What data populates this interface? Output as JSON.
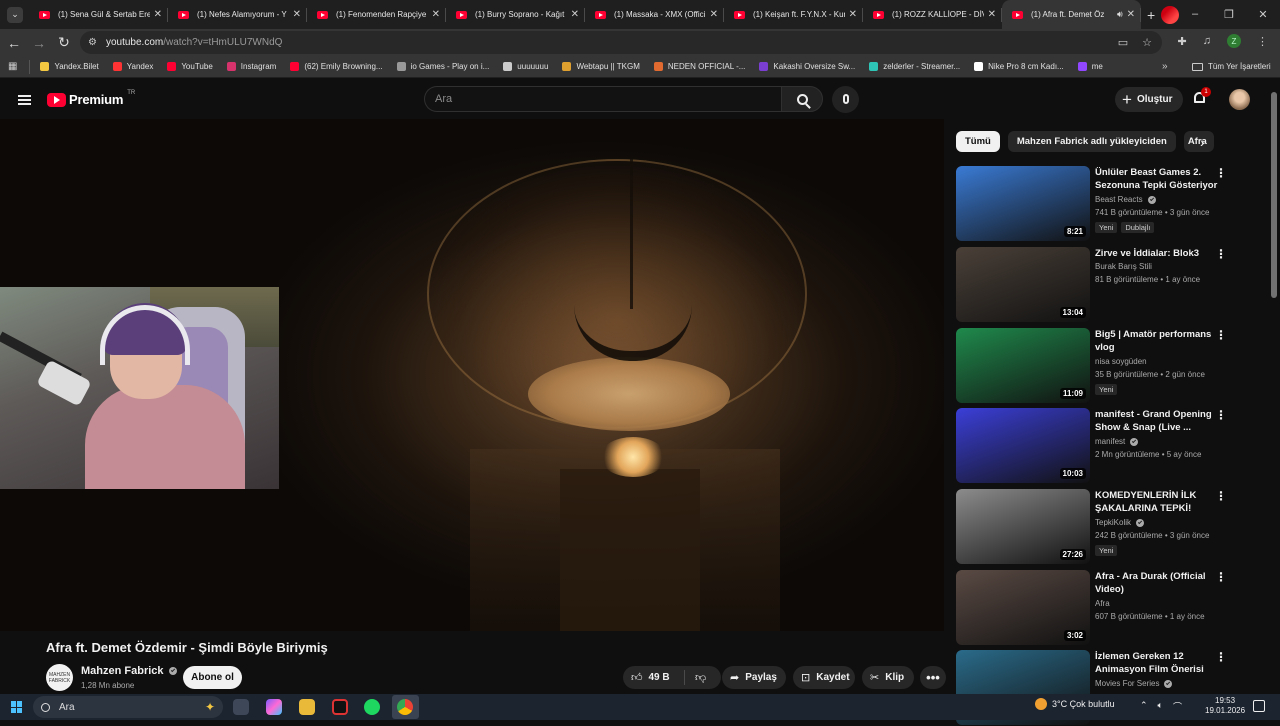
{
  "browser": {
    "tabs": [
      {
        "title": "(1) Sena Gül & Sertab Ere"
      },
      {
        "title": "(1) Nefes Alamıyorum - Y"
      },
      {
        "title": "(1) Fenomenden Rapçiye"
      },
      {
        "title": "(1) Burry Soprano - Kağıt"
      },
      {
        "title": "(1) Massaka - XMX (Offici"
      },
      {
        "title": "(1) Keişan ft. F.Y.N.X - Kur"
      },
      {
        "title": "(1) ROZZ KALLİOPE - DİV"
      },
      {
        "title": "(1) Afra ft. Demet Öz",
        "active": true
      }
    ],
    "url_host": "youtube.com",
    "url_path": "/watch?v=tHmULU7WNdQ",
    "bookmarks": [
      {
        "label": "Yandex.Bilet",
        "color": "#f5c842"
      },
      {
        "label": "Yandex",
        "color": "#ff3333"
      },
      {
        "label": "YouTube",
        "color": "#ff0033"
      },
      {
        "label": "Instagram",
        "color": "#d6336c"
      },
      {
        "label": "(62) Emily Browning...",
        "color": "#ff0033"
      },
      {
        "label": "io Games - Play on i...",
        "color": "#999999"
      },
      {
        "label": "uuuuuuu",
        "color": "#cccccc"
      },
      {
        "label": "Webtapu || TKGM",
        "color": "#e0a030"
      },
      {
        "label": "NEDEN OFFICIAL -...",
        "color": "#e06a30"
      },
      {
        "label": "Kakashi Oversize Sw...",
        "color": "#7a3fd1"
      },
      {
        "label": "zelderler - Streamer...",
        "color": "#2ec4b6"
      },
      {
        "label": "Nike Pro 8 cm Kadı...",
        "color": "#ffffff"
      },
      {
        "label": "me",
        "color": "#9146ff"
      }
    ],
    "all_bookmarks": "Tüm Yer İşaretleri",
    "profile_letter": "Z"
  },
  "youtube": {
    "logo_word": "Premium",
    "country": "TR",
    "search_placeholder": "Ara",
    "create_label": "Oluştur",
    "notif_count": "1"
  },
  "video": {
    "title": "Afra ft. Demet Özdemir - Şimdi Böyle Biriymiş",
    "channel": "Mahzen Fabrick",
    "channel_avatar_text": "MAHZEN FABRICK",
    "subscribers": "1,28 Mn abone",
    "subscribe_label": "Abone ol",
    "likes": "49 B",
    "share_label": "Paylaş",
    "save_label": "Kaydet",
    "clip_label": "Klip",
    "more_label": "•••"
  },
  "chips": [
    "Tümü",
    "Mahzen Fabrick adlı yükleyiciden",
    "Afra"
  ],
  "recommendations": [
    {
      "title": "Ünlüler Beast Games 2. Sezonuna Tepki Gösteriyor",
      "channel": "Beast Reacts",
      "verified": true,
      "meta": "741 B görüntüleme • 3 gün önce",
      "duration": "8:21",
      "tags": [
        "Yeni",
        "Dublajlı"
      ],
      "thumb_color": "#3a7bd5"
    },
    {
      "title": "Zirve ve İddialar: Blok3",
      "channel": "Burak Barış Stili",
      "verified": false,
      "meta": "81 B görüntüleme • 1 ay önce",
      "duration": "13:04",
      "tags": [],
      "thumb_color": "#4a4038"
    },
    {
      "title": "Big5 | Amatör performans vlog",
      "channel": "nisa soygüden",
      "verified": false,
      "meta": "35 B görüntüleme • 2 gün önce",
      "duration": "11:09",
      "tags": [
        "Yeni"
      ],
      "thumb_color": "#1f8a4c"
    },
    {
      "title": "manifest - Grand Opening Show & Snap (Live ...",
      "channel": "manifest",
      "verified": true,
      "meta": "2 Mn görüntüleme • 5 ay önce",
      "duration": "10:03",
      "tags": [],
      "thumb_color": "#3b3fd8"
    },
    {
      "title": "KOMEDYENLERİN İLK ŞAKALARINA TEPKİ!",
      "channel": "TepkiKolik",
      "verified": true,
      "meta": "242 B görüntüleme • 3 gün önce",
      "duration": "27:26",
      "tags": [
        "Yeni"
      ],
      "thumb_color": "#8c8c8c"
    },
    {
      "title": "Afra - Ara Durak (Official Video)",
      "channel": "Afra",
      "verified": false,
      "meta": "607 B görüntüleme • 1 ay önce",
      "duration": "3:02",
      "tags": [],
      "thumb_color": "#5a4a44"
    },
    {
      "title": "İzlemen Gereken 12 Animasyon Film Önerisi",
      "channel": "Movies For Series",
      "verified": true,
      "meta": "",
      "duration": "",
      "tags": [],
      "thumb_color": "#2a6b8a"
    }
  ],
  "taskbar": {
    "search_label": "Ara",
    "weather": "3°C  Çok bulutlu",
    "time": "19:53",
    "date": "19.01.2026"
  }
}
